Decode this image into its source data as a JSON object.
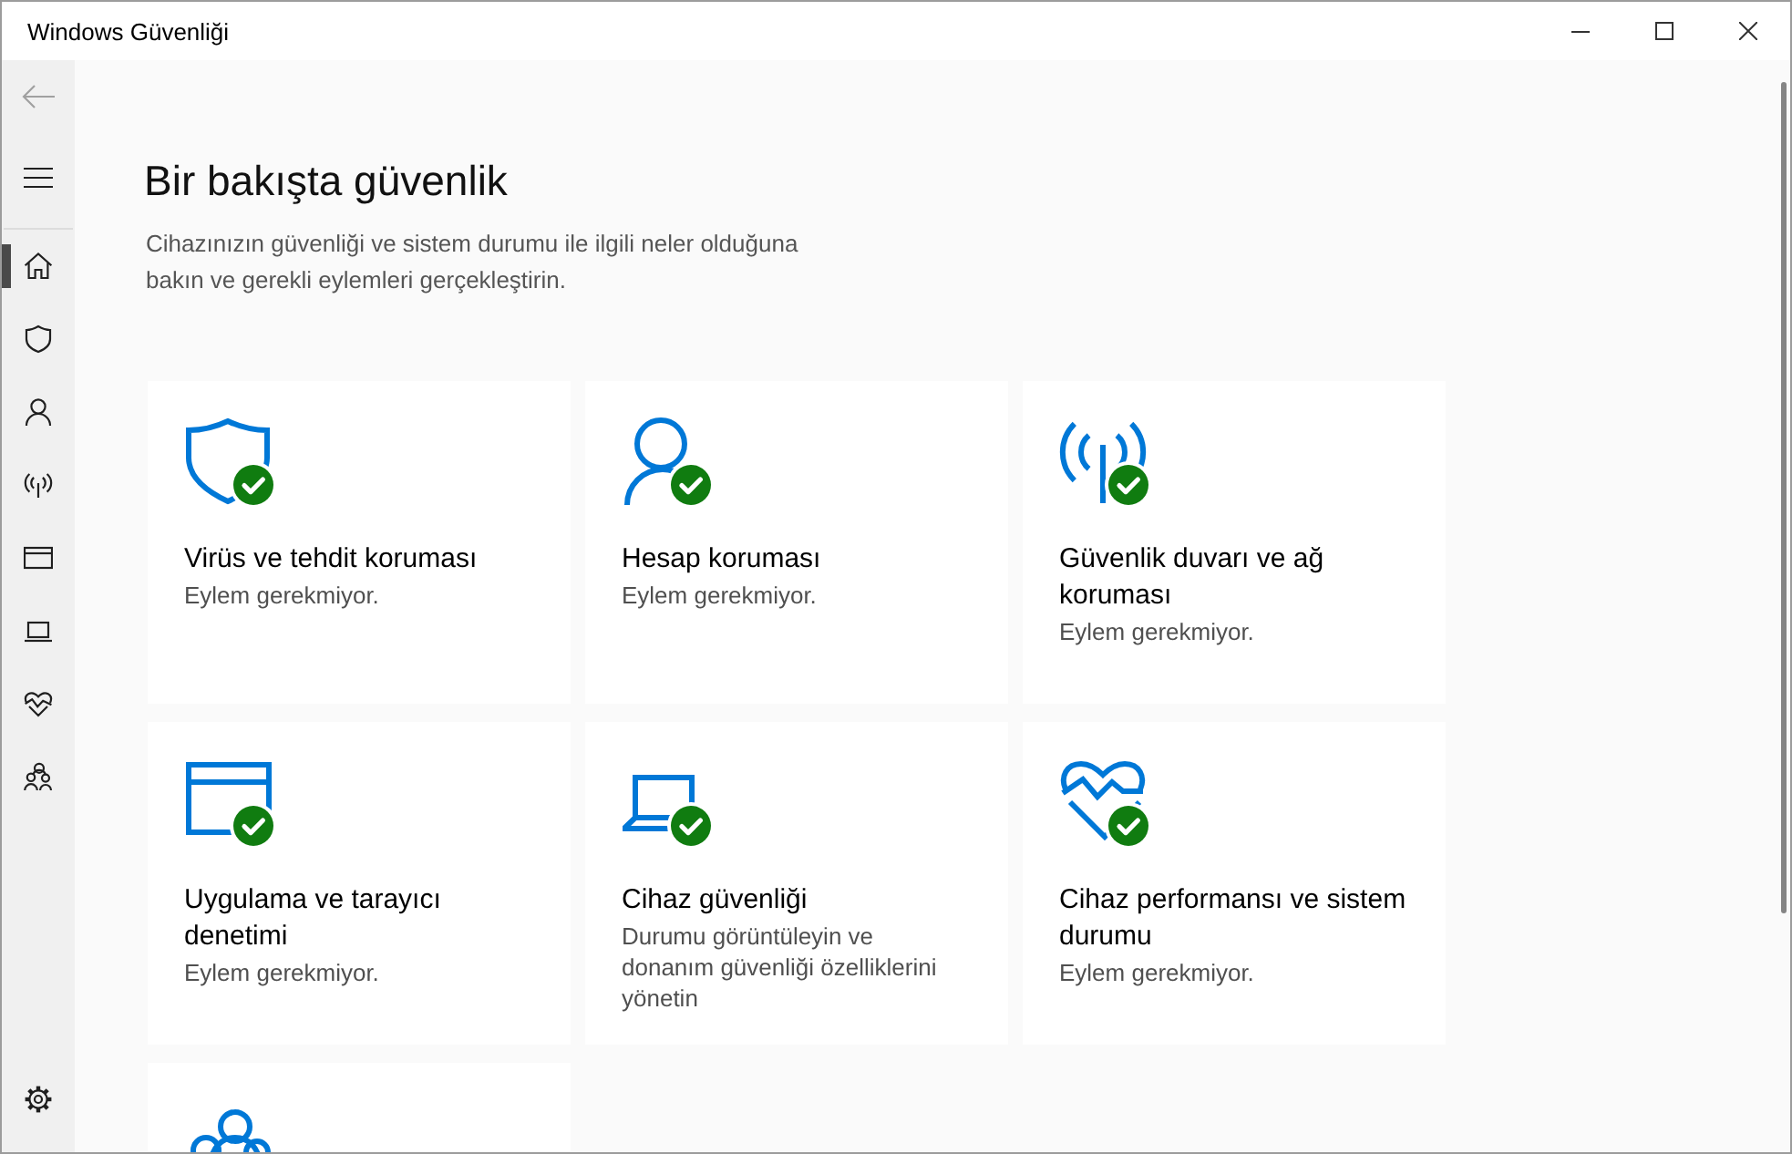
{
  "window": {
    "title": "Windows Güvenliği"
  },
  "sidebar": {
    "back_button": {
      "disabled": true
    },
    "items": [
      {
        "kind": "home",
        "selected": true
      },
      {
        "kind": "shield",
        "selected": false
      },
      {
        "kind": "account",
        "selected": false
      },
      {
        "kind": "network",
        "selected": false
      },
      {
        "kind": "app",
        "selected": false
      },
      {
        "kind": "device",
        "selected": false
      },
      {
        "kind": "health",
        "selected": false
      },
      {
        "kind": "family",
        "selected": false
      }
    ]
  },
  "page": {
    "heading": "Bir bakışta güvenlik",
    "description": "Cihazınızın güvenliği ve sistem durumu ile ilgili neler olduğuna bakın ve gerekli eylemleri gerçekleştirin."
  },
  "cards": [
    {
      "kind": "shield",
      "ok": true,
      "title": "Virüs ve tehdit koruması",
      "subtitle": "Eylem gerekmiyor."
    },
    {
      "kind": "account",
      "ok": true,
      "title": "Hesap koruması",
      "subtitle": "Eylem gerekmiyor."
    },
    {
      "kind": "network",
      "ok": true,
      "title": "Güvenlik duvarı ve ağ koruması",
      "subtitle": "Eylem gerekmiyor."
    },
    {
      "kind": "app",
      "ok": true,
      "title": "Uygulama ve tarayıcı denetimi",
      "subtitle": "Eylem gerekmiyor."
    },
    {
      "kind": "device",
      "ok": true,
      "title": "Cihaz güvenliği",
      "subtitle": "Durumu görüntüleyin ve donanım güvenliği özelliklerini yönetin"
    },
    {
      "kind": "health",
      "ok": true,
      "title": "Cihaz performansı ve sistem durumu",
      "subtitle": "Eylem gerekmiyor."
    },
    {
      "kind": "family"
    }
  ]
}
